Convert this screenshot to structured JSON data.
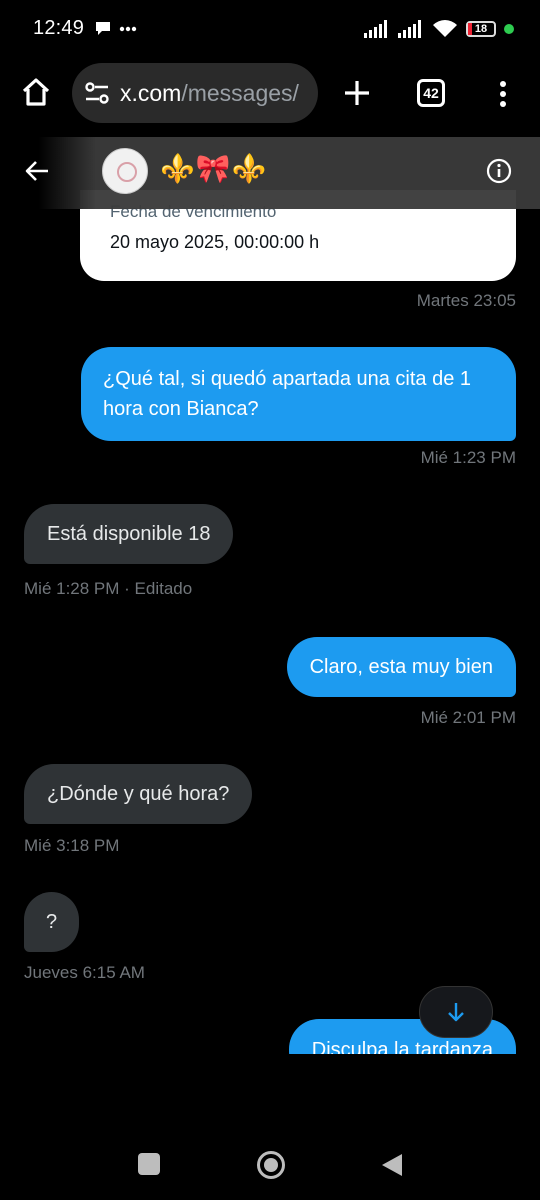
{
  "status_bar": {
    "time": "12:49",
    "battery": "18"
  },
  "browser": {
    "url_host": "x.com",
    "url_path": "/messages/",
    "tab_count": "42"
  },
  "chat_header": {
    "name": "⚜️🎀⚜️"
  },
  "card": {
    "label": "Fecha de vencimiento",
    "value": "20 mayo 2025, 00:00:00 h",
    "timestamp": "Martes 23:05"
  },
  "messages": [
    {
      "text": "¿Qué tal, si quedó apartada una cita de 1 hora con Bianca?",
      "meta": "Mié 1:23 PM"
    },
    {
      "text": "Está disponible 18",
      "meta": "Mié 1:28 PM · Editado"
    },
    {
      "text": "Claro, esta muy bien",
      "meta": "Mié 2:01 PM"
    },
    {
      "text": "¿Dónde y qué hora?",
      "meta": "Mié 3:18 PM"
    },
    {
      "text": "?",
      "meta": "Jueves 6:15 AM"
    },
    {
      "text": "Disculpa la tardanza"
    }
  ],
  "colors": {
    "accent": "#1d9bf0",
    "received_bubble": "#2f3336",
    "meta_text": "#71767b"
  }
}
